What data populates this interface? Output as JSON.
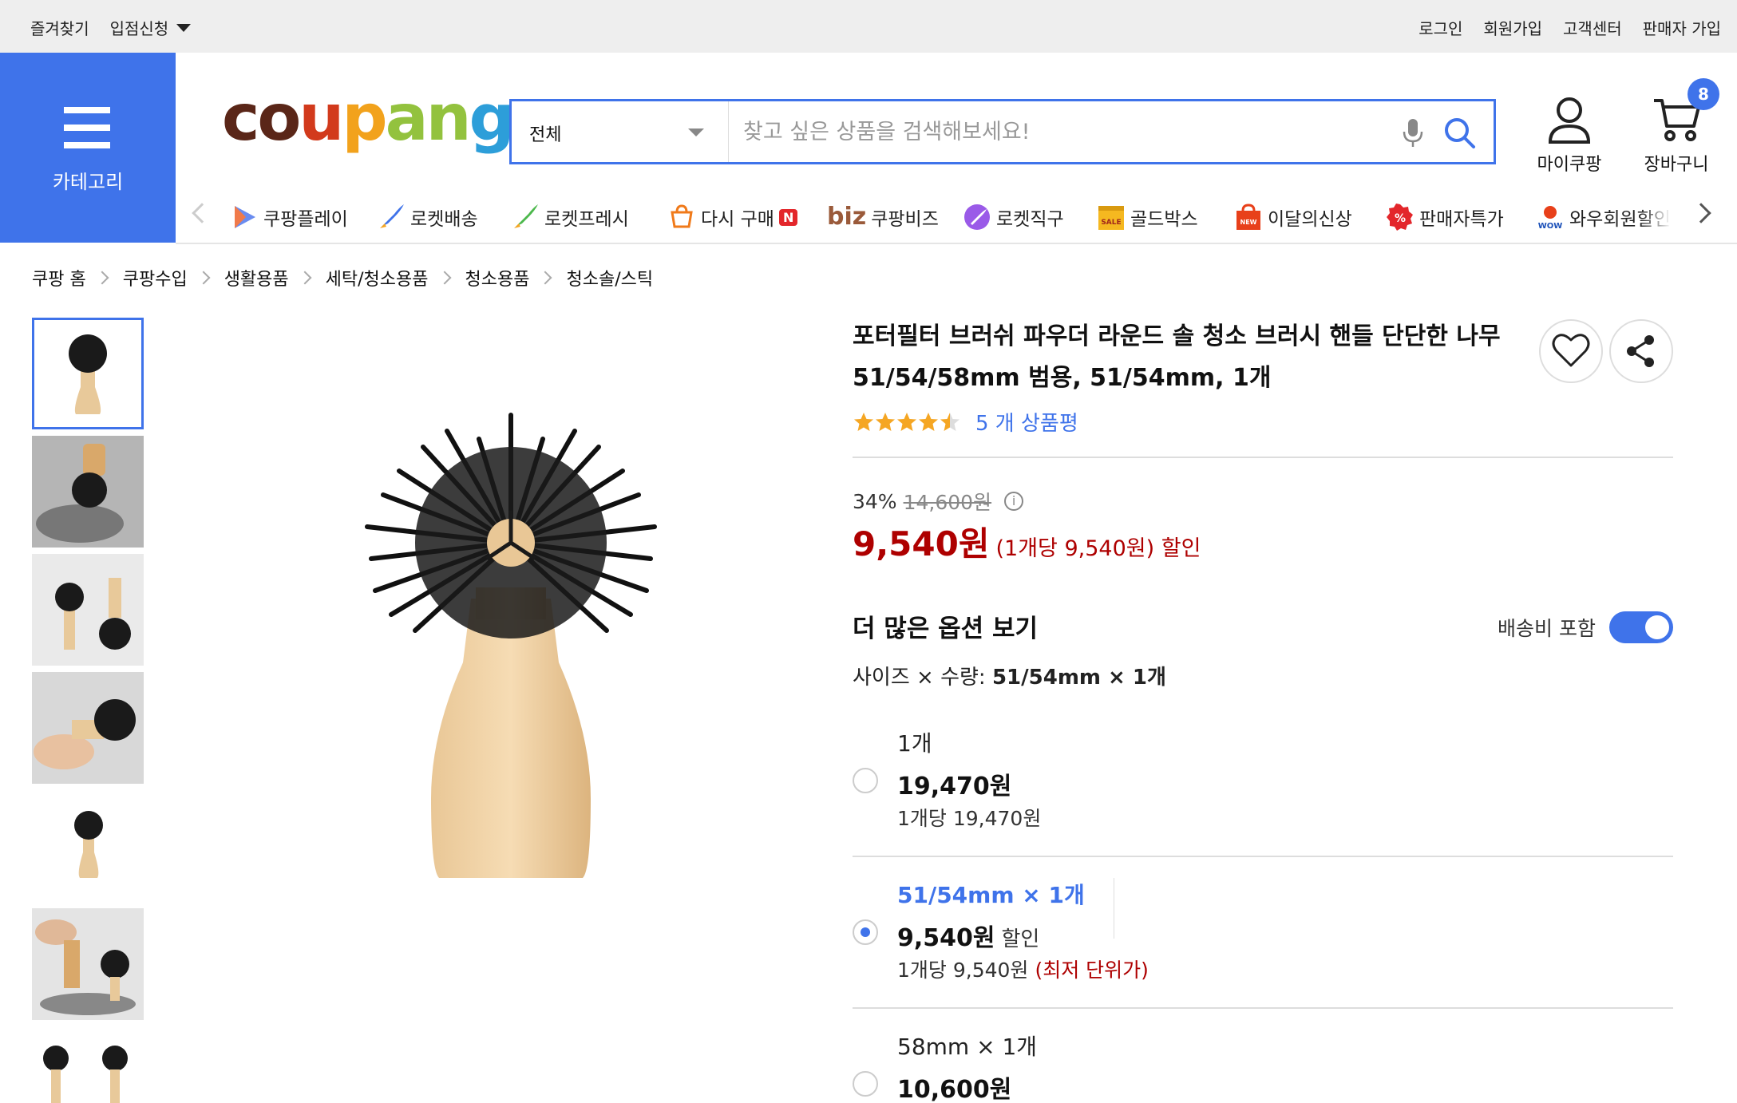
{
  "topbar": {
    "left": [
      "즐겨찾기",
      "입점신청"
    ],
    "right": [
      "로그인",
      "회원가입",
      "고객센터",
      "판매자 가입"
    ]
  },
  "category_label": "카테고리",
  "logo": {
    "parts": [
      "co",
      "u",
      "p",
      "an",
      "g"
    ]
  },
  "search": {
    "category": "전체",
    "placeholder": "찾고 싶은 상품을 검색해보세요!"
  },
  "header_icons": {
    "my": "마이쿠팡",
    "cart": "장바구니",
    "cart_count": "8"
  },
  "nav": [
    {
      "label": "쿠팡플레이",
      "icon": "play-icon"
    },
    {
      "label": "로켓배송",
      "icon": "rocket-icon"
    },
    {
      "label": "로켓프레시",
      "icon": "rocket-fresh-icon"
    },
    {
      "label": "다시 구매",
      "icon": "rebuy-icon",
      "badge": "N"
    },
    {
      "label": "쿠팡비즈",
      "icon": "biz-icon",
      "prefix": "biz"
    },
    {
      "label": "로켓직구",
      "icon": "rocket-global-icon"
    },
    {
      "label": "골드박스",
      "icon": "goldbox-icon"
    },
    {
      "label": "이달의신상",
      "icon": "new-bag-icon"
    },
    {
      "label": "판매자특가",
      "icon": "percent-icon"
    },
    {
      "label": "와우회원할인",
      "icon": "wow-icon"
    }
  ],
  "breadcrumb": [
    "쿠팡 홈",
    "쿠팡수입",
    "생활용품",
    "세탁/청소용품",
    "청소용품",
    "청소솔/스틱"
  ],
  "product": {
    "title_line1": "포터필터 브러쉬 파우더 라운드 솔 청소 브러시 핸들 단단한 나무",
    "title_line2": "51/54/58mm 범용, 51/54mm, 1개",
    "rating_stars": 4.5,
    "review_text": "5 개 상품평",
    "discount_rate": "34%",
    "original_price": "14,600원",
    "sale_price": "9,540원",
    "unit_price": "(1개당 9,540원) 할인"
  },
  "options": {
    "heading": "더 많은 옵션 보기",
    "shipping_toggle_label": "배송비 포함",
    "shipping_toggle_on": true,
    "size_qty_label": "사이즈 × 수량: ",
    "size_qty_value": "51/54mm × 1개",
    "items": [
      {
        "name": "1개",
        "price": "19,470원",
        "discount": "",
        "unit": "1개당 19,470원",
        "note": "",
        "selected": false
      },
      {
        "name": "51/54mm × 1개",
        "price": "9,540원",
        "discount": "할인",
        "unit": "1개당 9,540원",
        "note": "(최저 단위가)",
        "selected": true
      },
      {
        "name": "58mm × 1개",
        "price": "10,600원",
        "discount": "",
        "unit": "",
        "note": "",
        "selected": false
      }
    ]
  },
  "colors": {
    "brand_blue": "#3f73ea",
    "price_red": "#ae0000",
    "star": "#f5a623"
  }
}
